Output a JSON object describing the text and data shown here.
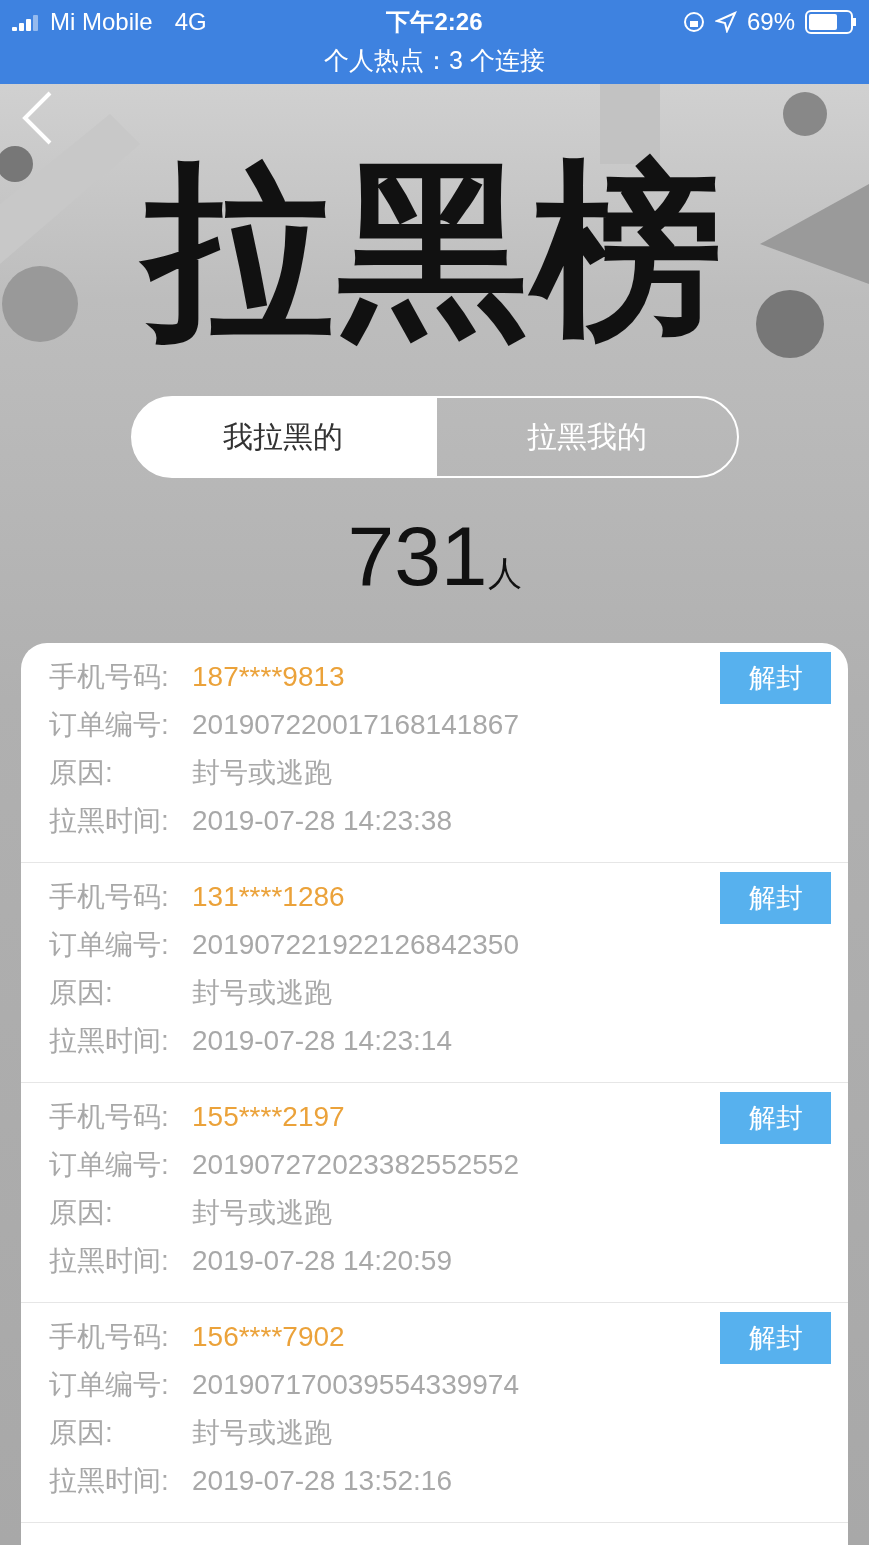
{
  "status_bar": {
    "carrier": "Mi Mobile",
    "network": "4G",
    "time": "下午2:26",
    "battery_text": "69%",
    "hotspot": "个人热点：3 个连接"
  },
  "banner": {
    "title": "拉黑榜"
  },
  "tabs": [
    {
      "label": "我拉黑的",
      "selected": true
    },
    {
      "label": "拉黑我的",
      "selected": false
    }
  ],
  "count": {
    "number": "731",
    "unit": "人"
  },
  "records": [
    {
      "labels": [
        "手机号码:",
        "订单编号:",
        "原因:",
        "拉黑时间:"
      ],
      "phone": "187****9813",
      "order": "201907220017168141867",
      "reason": "封号或逃跑",
      "time": "2019-07-28 14:23:38",
      "button": "解封"
    },
    {
      "labels": [
        "手机号码:",
        "订单编号:",
        "原因:",
        "拉黑时间:"
      ],
      "phone": "131****1286",
      "order": "201907221922126842350",
      "reason": "封号或逃跑",
      "time": "2019-07-28 14:23:14",
      "button": "解封"
    },
    {
      "labels": [
        "手机号码:",
        "订单编号:",
        "原因:",
        "拉黑时间:"
      ],
      "phone": "155****2197",
      "order": "201907272023382552552",
      "reason": "封号或逃跑",
      "time": "2019-07-28 14:20:59",
      "button": "解封"
    },
    {
      "labels": [
        "手机号码:",
        "订单编号:",
        "原因:",
        "拉黑时间:"
      ],
      "phone": "156****7902",
      "order": "201907170039554339974",
      "reason": "封号或逃跑",
      "time": "2019-07-28 13:52:16",
      "button": "解封"
    }
  ]
}
